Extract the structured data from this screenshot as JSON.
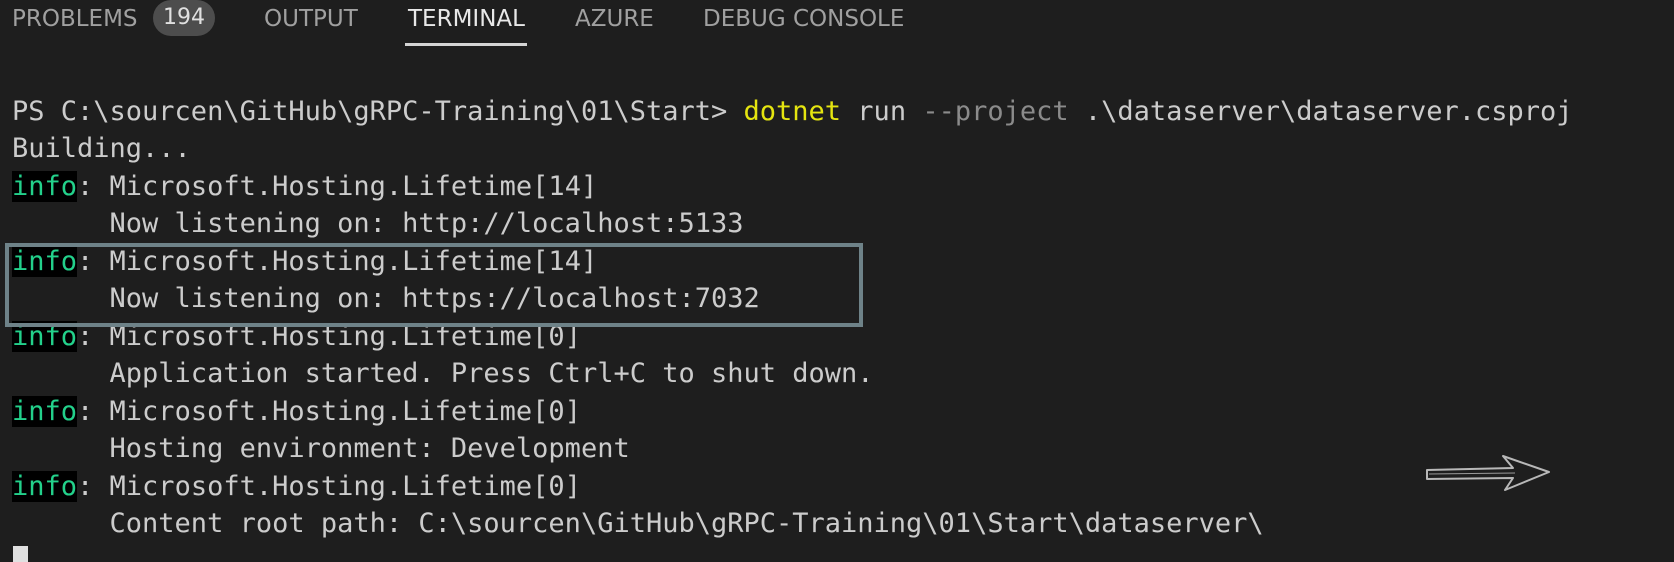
{
  "tabs": [
    {
      "label": "PROBLEMS",
      "badge": "194"
    },
    {
      "label": "OUTPUT"
    },
    {
      "label": "TERMINAL",
      "active": true
    },
    {
      "label": "AZURE"
    },
    {
      "label": "DEBUG CONSOLE"
    }
  ],
  "terminal": {
    "prompt": "PS C:\\sourcen\\GitHub\\gRPC-Training\\01\\Start> ",
    "command": "dotnet",
    "arg1": " run ",
    "param": "--project",
    "arg2": " .\\dataserver\\dataserver.csproj",
    "building": "Building...",
    "info_tag": "info",
    "entries": [
      {
        "source": ": Microsoft.Hosting.Lifetime[14]",
        "message": "      Now listening on: http://localhost:5133"
      },
      {
        "source": ": Microsoft.Hosting.Lifetime[14]",
        "message": "      Now listening on: https://localhost:7032"
      },
      {
        "source": ": Microsoft.Hosting.Lifetime[0]",
        "message": "      Application started. Press Ctrl+C to shut down."
      },
      {
        "source": ": Microsoft.Hosting.Lifetime[0]",
        "message": "      Hosting environment: Development"
      },
      {
        "source": ": Microsoft.Hosting.Lifetime[0]",
        "message": "      Content root path: C:\\sourcen\\GitHub\\gRPC-Training\\01\\Start\\dataserver\\"
      }
    ]
  },
  "colors": {
    "background": "#1e1e1e",
    "info": "#23d18b",
    "command": "#e5e510",
    "param": "#8b8b8b",
    "highlight_border": "#6e8288"
  },
  "annotations": {
    "highlight": "box around https listening entry",
    "arrow": "hand-drawn-arrow-icon"
  }
}
